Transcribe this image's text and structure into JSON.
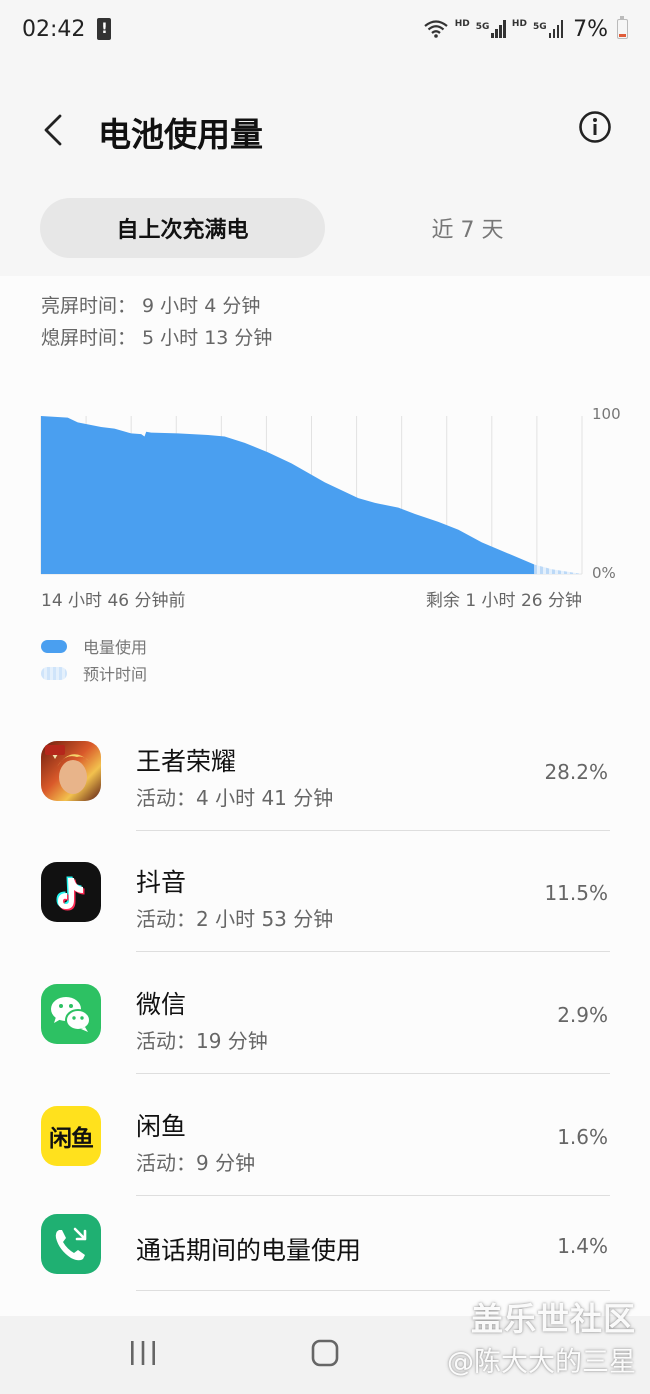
{
  "status_bar": {
    "time": "02:42",
    "alert_glyph": "!",
    "hd_label_1": "HD",
    "net_label_1": "5G",
    "hd_label_2": "HD",
    "net_label_2": "5G",
    "battery_percent": "7%"
  },
  "header": {
    "title": "电池使用量",
    "back_icon": "chevron-left-icon",
    "info_icon": "info-circle-icon"
  },
  "tabs": [
    {
      "label": "自上次充满电",
      "active": true
    },
    {
      "label": "近 7 天",
      "active": false
    }
  ],
  "screen_time": {
    "on": "亮屏时间：  9 小时 4 分钟",
    "off": "熄屏时间：  5 小时 13 分钟"
  },
  "chart_data": {
    "type": "area",
    "y_max_label": "100",
    "y_min_label": "0%",
    "ylim": [
      0,
      100
    ],
    "x_start_label": "14 小时 46 分钟前",
    "x_end_label": "剩余 1 小时 26 分钟",
    "used_color": "#4a9ff0",
    "estimate_color": "#cfe4fa",
    "series": [
      {
        "name": "电量使用",
        "x_hours_from_full": [
          0,
          0.8,
          1.1,
          1.8,
          2.2,
          2.7,
          3.0,
          3.1,
          3.15,
          3.3,
          4.1,
          5.0,
          5.5,
          6.1,
          6.8,
          7.5,
          8.0,
          8.5,
          9.0,
          9.5,
          10.0,
          10.7,
          11.2,
          11.9,
          12.5,
          13.2,
          14.1,
          14.77
        ],
        "values": [
          100,
          99,
          96,
          93,
          92,
          89,
          88.5,
          87,
          90,
          89.5,
          89,
          88,
          87,
          83,
          77,
          70,
          64,
          58,
          53,
          48,
          45,
          42,
          38,
          33,
          28,
          20,
          12,
          6
        ]
      },
      {
        "name": "预计时间",
        "x_hours_from_full": [
          14.77,
          15.3,
          16.2
        ],
        "values": [
          6,
          3,
          0
        ]
      }
    ],
    "legend": [
      {
        "label": "电量使用",
        "style": "solid"
      },
      {
        "label": "预计时间",
        "style": "striped"
      }
    ],
    "grid": true
  },
  "apps": [
    {
      "name": "王者荣耀",
      "sub": "活动：4 小时 41 分钟",
      "percent": "28.2%",
      "icon": "honor-of-kings-icon",
      "icon_color": "#c9461f"
    },
    {
      "name": "抖音",
      "sub": "活动：2 小时 53 分钟",
      "percent": "11.5%",
      "icon": "douyin-icon",
      "icon_color": "#111111"
    },
    {
      "name": "微信",
      "sub": "活动：19 分钟",
      "percent": "2.9%",
      "icon": "wechat-icon",
      "icon_color": "#2dc163"
    },
    {
      "name": "闲鱼",
      "sub": "活动：9 分钟",
      "percent": "1.6%",
      "icon": "xianyu-icon",
      "icon_color": "#ffe11d"
    },
    {
      "name": "通话期间的电量使用",
      "sub": "",
      "percent": "1.4%",
      "icon": "phone-call-icon",
      "icon_color": "#1fb072"
    }
  ],
  "xianyu_logo_text": "闲鱼",
  "nav": {
    "recent_icon": "recent-apps-icon",
    "home_icon": "home-icon"
  },
  "watermark": {
    "line1": "盖乐世社区",
    "line2": "@陈大大的三星"
  }
}
